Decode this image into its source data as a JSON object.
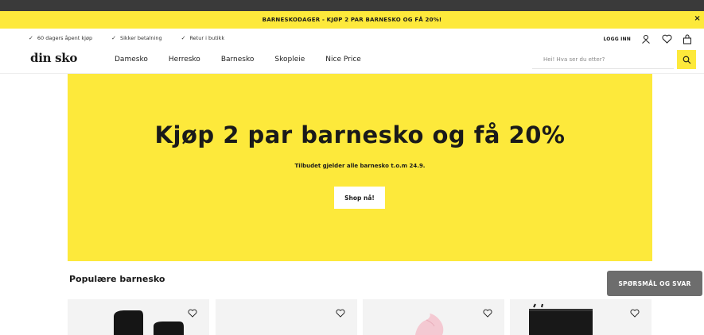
{
  "promo_bar": {
    "text": "BARNESKODAGER - KJØP 2 PAR BARNESKO OG FÅ 20%!",
    "close": "×"
  },
  "usp": [
    "60 dagers åpent kjøp",
    "Sikker betalning",
    "Retur i butikk"
  ],
  "account": {
    "login": "LOGG INN"
  },
  "logo": "din sko",
  "nav": [
    "Damesko",
    "Herresko",
    "Barnesko",
    "Skopleie",
    "Nice Price"
  ],
  "search": {
    "placeholder": "Hei! Hva ser du etter?"
  },
  "hero": {
    "title": "Kjøp 2 par barnesko og få 20%",
    "subtitle": "Tilbudet gjelder alle barnesko t.o.m 24.9.",
    "cta": "Shop nå!"
  },
  "section_title": "Populære barnesko",
  "faq_button": "SPØRSMÅL OG SVAR",
  "colors": {
    "accent": "#fde93b",
    "dark": "#1a1a1a",
    "faq": "#6d6d6d"
  }
}
